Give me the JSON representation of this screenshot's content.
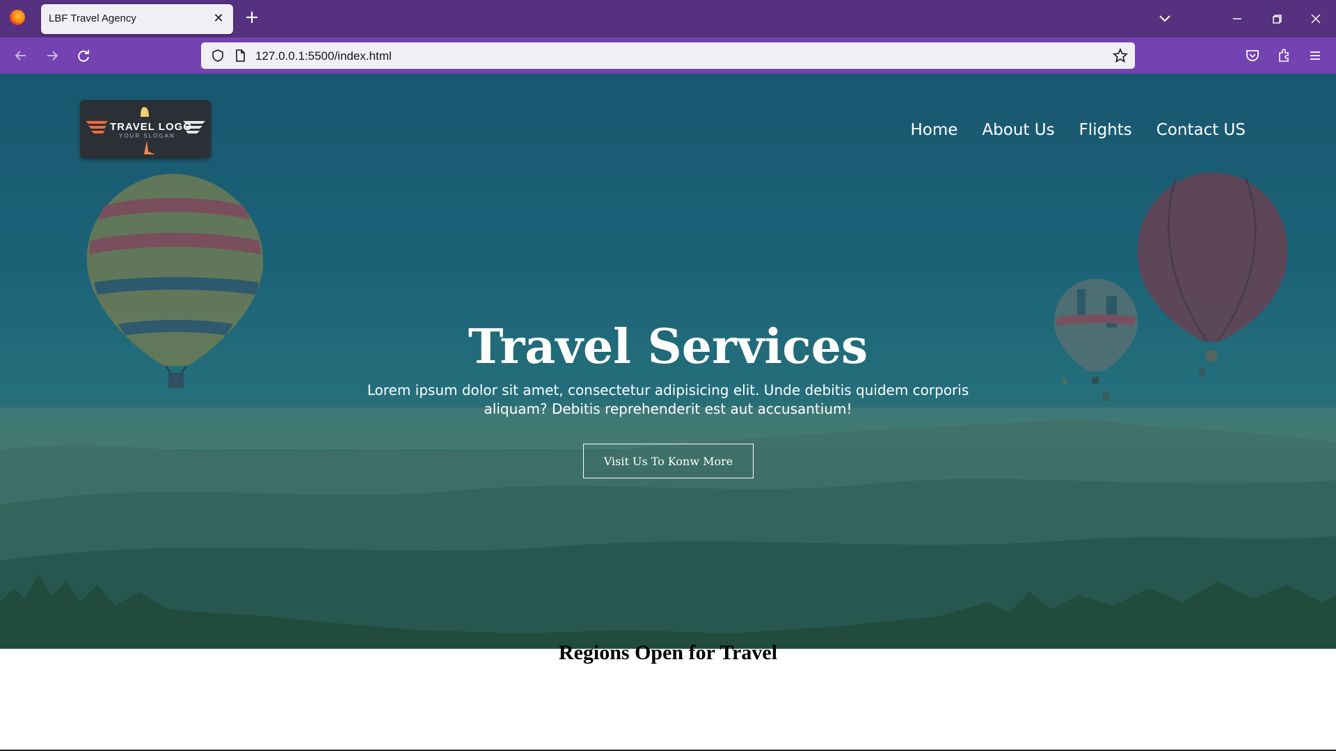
{
  "browser": {
    "tab_title": "LBF Travel Agency",
    "close_glyph": "✕",
    "newtab_glyph": "+",
    "url": "127.0.0.1:5500/index.html"
  },
  "site": {
    "logo_text": "TRAVEL LOGO",
    "logo_slogan": "YOUR SLOGAN",
    "nav": [
      "Home",
      "About Us",
      "Flights",
      "Contact US"
    ],
    "hero": {
      "title": "Travel Services",
      "description": "Lorem ipsum dolor sit amet, consectetur adipisicing elit. Unde debitis quidem corporis aliquam? Debitis reprehenderit est aut accusantium!",
      "button_label": "Visit Us To Konw More"
    },
    "section_title": "Regions Open for Travel"
  },
  "colors": {
    "tabbar": "#55317f",
    "navbar": "#7542b2",
    "url_bg": "#f0f0f4"
  }
}
